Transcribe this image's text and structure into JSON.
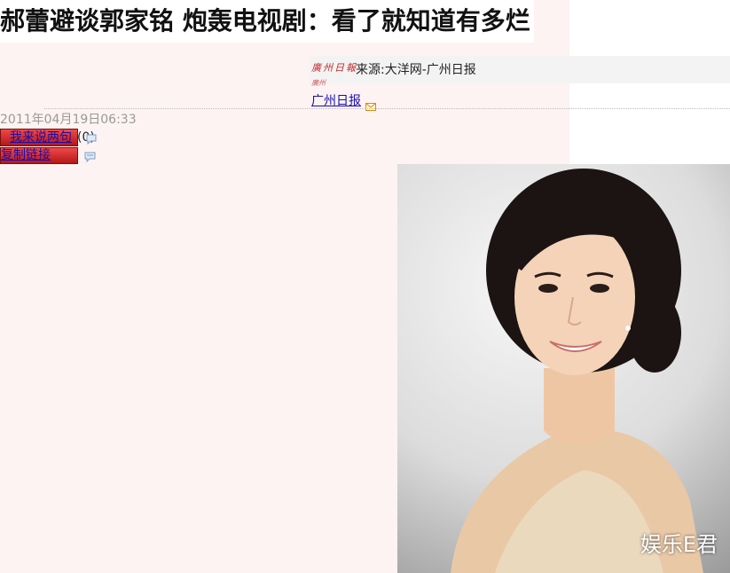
{
  "article": {
    "headline": "郝蕾避谈郭家铭 炮轰电视剧：看了就知道有多烂",
    "publish_time": "2011年04月19日06:33"
  },
  "source": {
    "logo_text": "广州日报",
    "text": "来源:大洋网-广州日报",
    "link_text": "广州日报"
  },
  "actions": {
    "comment_label": "我来说两句",
    "comment_count": "(0)",
    "copy_link_label": "复制链接"
  },
  "photo": {
    "watermark": "娱乐E君"
  },
  "colors": {
    "page_background": "#fdf3f3",
    "link": "#1a0dab",
    "button_red": "#d32f2f",
    "logo_red": "#c62828"
  },
  "icons": [
    "mail-icon",
    "comment-bubble-icon",
    "comment-bubble-icon"
  ]
}
